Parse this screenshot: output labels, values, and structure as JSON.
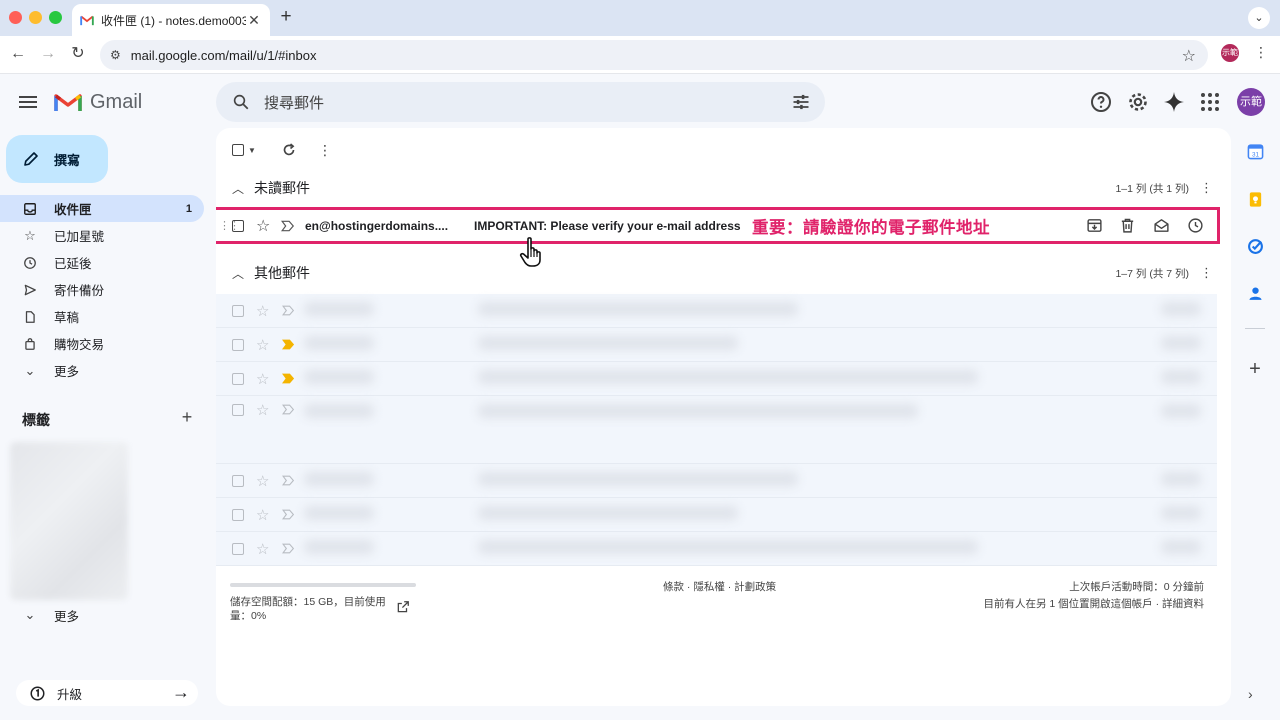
{
  "browser": {
    "tab_title": "收件匣 (1) - notes.demo003@",
    "tab_close": "✕",
    "new_tab": "+",
    "url": "mail.google.com/mail/u/1/#inbox",
    "profile_chip": "示範",
    "colors": {
      "close": "#ff5f57",
      "minimize": "#febc2e",
      "zoom": "#28c840"
    }
  },
  "gmail": {
    "logo_text": "Gmail",
    "search_placeholder": "搜尋郵件",
    "avatar": "示範",
    "compose_label": "撰寫",
    "nav": [
      {
        "label": "收件匣",
        "count": "1",
        "icon": "inbox-icon"
      },
      {
        "label": "已加星號",
        "count": "",
        "icon": "star-icon"
      },
      {
        "label": "已延後",
        "count": "",
        "icon": "clock-icon"
      },
      {
        "label": "寄件備份",
        "count": "",
        "icon": "send-icon"
      },
      {
        "label": "草稿",
        "count": "",
        "icon": "draft-icon"
      },
      {
        "label": "購物交易",
        "count": "",
        "icon": "shopping-icon"
      },
      {
        "label": "更多",
        "count": "",
        "icon": "chevron-down-icon"
      }
    ],
    "labels_title": "標籤",
    "labels_more": "更多",
    "upgrade_label": "升級",
    "accent": "#e0236a"
  },
  "main": {
    "unread_section": {
      "title": "未讀郵件",
      "count": "1–1 列 (共 1 列)"
    },
    "other_section": {
      "title": "其他郵件",
      "count": "1–7 列 (共 7 列)"
    },
    "highlight_email": {
      "sender": "en@hostingerdomains....",
      "subject": "IMPORTANT: Please verify your e-mail address",
      "callout": "重要：請驗證你的電子郵件地址"
    },
    "footer": {
      "storage": "儲存空間配額：15 GB，目前使用量：0%",
      "policy": "條款 · 隱私權 · 計劃政策",
      "activity_1": "上次帳戶活動時間：0 分鐘前",
      "activity_2": "目前有人在另 1 個位置開啟這個帳戶 · 詳細資料"
    }
  }
}
